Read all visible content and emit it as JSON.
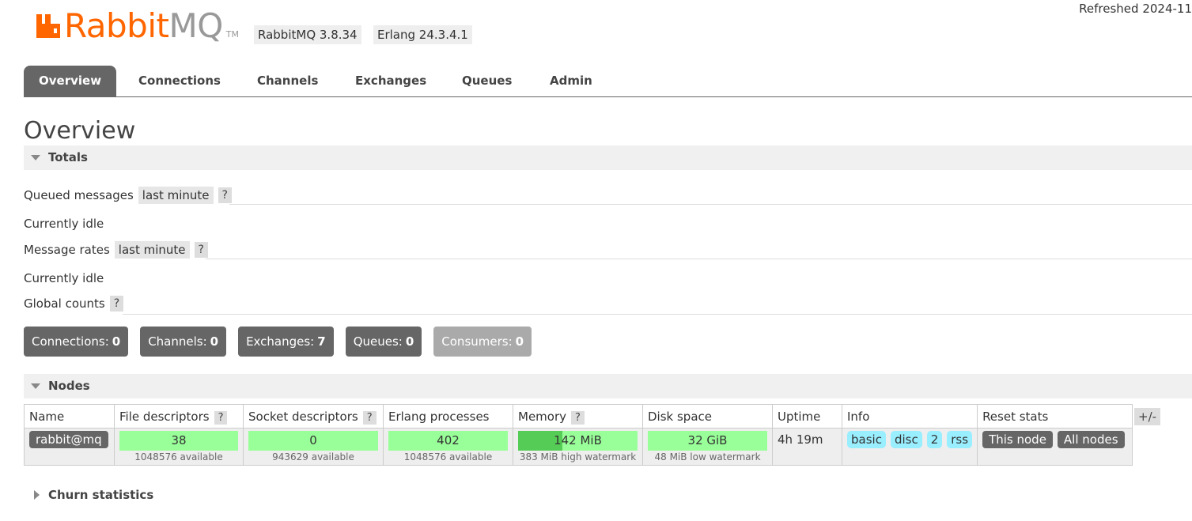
{
  "header": {
    "logo_primary": "Rabbit",
    "logo_secondary": "MQ",
    "logo_tm": "TM",
    "rabbitmq_version": "RabbitMQ 3.8.34",
    "erlang_version": "Erlang 24.3.4.1",
    "refreshed": "Refreshed 2024-11"
  },
  "tabs": [
    {
      "label": "Overview",
      "active": true
    },
    {
      "label": "Connections"
    },
    {
      "label": "Channels"
    },
    {
      "label": "Exchanges"
    },
    {
      "label": "Queues"
    },
    {
      "label": "Admin"
    }
  ],
  "page_title": "Overview",
  "totals": {
    "title": "Totals",
    "queued_label": "Queued messages",
    "queued_range": "last minute",
    "help": "?",
    "queued_status": "Currently idle",
    "rates_label": "Message rates",
    "rates_range": "last minute",
    "rates_status": "Currently idle",
    "global_label": "Global counts",
    "counts": {
      "connections_label": "Connections:",
      "connections": "0",
      "channels_label": "Channels:",
      "channels": "0",
      "exchanges_label": "Exchanges:",
      "exchanges": "7",
      "queues_label": "Queues:",
      "queues": "0",
      "consumers_label": "Consumers:",
      "consumers": "0"
    }
  },
  "nodes": {
    "title": "Nodes",
    "headers": {
      "name": "Name",
      "file_desc": "File descriptors",
      "socket_desc": "Socket descriptors",
      "erlang_proc": "Erlang processes",
      "memory": "Memory",
      "disk": "Disk space",
      "uptime": "Uptime",
      "info": "Info",
      "reset": "Reset stats"
    },
    "row": {
      "name": "rabbit@mq",
      "file_desc": "38",
      "file_desc_sub": "1048576 available",
      "socket_desc": "0",
      "socket_desc_sub": "943629 available",
      "erlang_proc": "402",
      "erlang_proc_sub": "1048576 available",
      "memory": "142 MiB",
      "memory_used_pct": 37,
      "memory_sub": "383 MiB high watermark",
      "disk": "32 GiB",
      "disk_sub": "48 MiB low watermark",
      "uptime": "4h 19m",
      "info_tags": [
        "basic",
        "disc",
        "2",
        "rss"
      ],
      "reset_this": "This node",
      "reset_all": "All nodes"
    },
    "plus_minus": "+/-"
  },
  "churn": {
    "title": "Churn statistics"
  }
}
